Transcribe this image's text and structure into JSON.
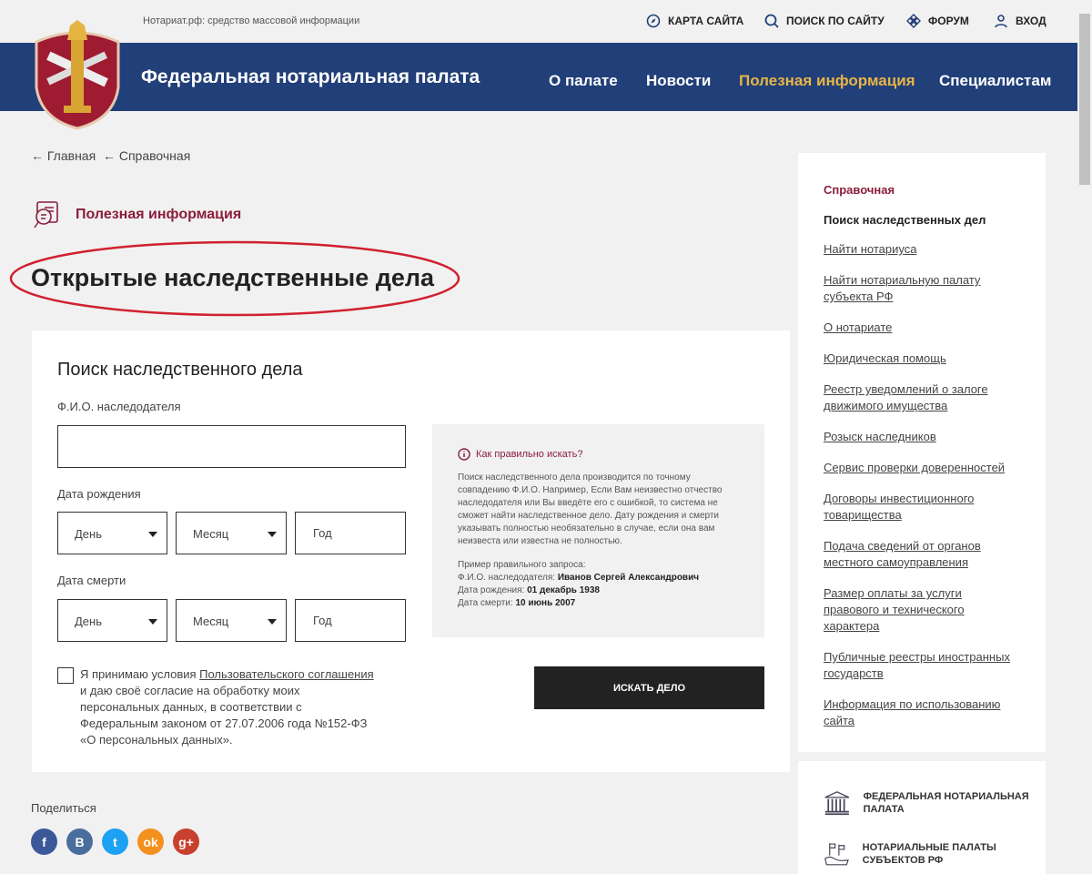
{
  "header": {
    "tagline": "Нотариат.рф: средство массовой информации",
    "site_title": "Федеральная нотариальная палата",
    "top_links": [
      {
        "label": "КАРТА САЙТА",
        "icon": "compass-icon"
      },
      {
        "label": "ПОИСК ПО САЙТУ",
        "icon": "search-icon"
      },
      {
        "label": "ФОРУМ",
        "icon": "forum-icon"
      },
      {
        "label": "ВХОД",
        "icon": "user-icon"
      }
    ],
    "nav": [
      {
        "label": "О палате"
      },
      {
        "label": "Новости"
      },
      {
        "label": "Полезная информация",
        "active": true
      },
      {
        "label": "Специалистам"
      }
    ],
    "colors": {
      "brand": "#213f78",
      "accent": "#e8b547",
      "section": "#8a1e3c"
    }
  },
  "breadcrumb": {
    "items": [
      "Главная",
      "Справочная"
    ]
  },
  "section_label": "Полезная информация",
  "page_title": "Открытые наследственные дела",
  "form": {
    "title": "Поиск наследственного дела",
    "name_label": "Ф.И.О. наследодателя",
    "name_value": "",
    "birth_label": "Дата рождения",
    "death_label": "Дата смерти",
    "day": "День",
    "month": "Месяц",
    "year": "Год",
    "agree_pre": "Я принимаю условия ",
    "agree_link": "Пользовательского соглашения",
    "agree_post": " и даю своё согласие на обработку моих персональных данных, в соответствии с Федеральным законом от 27.07.2006 года №152-ФЗ «О персональных данных».",
    "submit": "ИСКАТЬ ДЕЛО"
  },
  "hint": {
    "title": "Как правильно искать?",
    "text": "Поиск наследственного дела производится по точному совпадению Ф.И.О. Например, Если Вам неизвестно отчество наследодателя или Вы введёте его с ошибкой, то система не сможет найти наследственное дело. Дату рождения и смерти указывать полностью необязательно в случае, если она вам неизвеста или известна не полностью.",
    "example_title": "Пример правильного запроса:",
    "ex_name_label": "Ф.И.О. наследодателя: ",
    "ex_name": "Иванов Сергей Александрович",
    "ex_birth_label": "Дата рождения: ",
    "ex_birth": "01 декабрь 1938",
    "ex_death_label": "Дата смерти: ",
    "ex_death": "10 июнь 2007"
  },
  "sidebar": {
    "heading": "Справочная",
    "current": "Поиск наследственных дел",
    "links": [
      "Найти нотариуса",
      "Найти нотариальную палату субъекта РФ",
      "О нотариате",
      "Юридическая помощь",
      "Реестр уведомлений о залоге движимого имущества",
      "Розыск наследников",
      "Сервис проверки доверенностей",
      "Договоры инвестиционного товарищества",
      "Подача сведений от органов местного самоуправления",
      "Размер оплаты за услуги правового и технического характера",
      "Публичные реестры иностранных государств",
      "Информация по использованию сайта"
    ]
  },
  "sidebar2": {
    "items": [
      "ФЕДЕРАЛЬНАЯ НОТАРИАЛЬНАЯ ПАЛАТА",
      "НОТАРИАЛЬНЫЕ ПАЛАТЫ СУБЪЕКТОВ РФ"
    ]
  },
  "share": {
    "label": "Поделиться",
    "networks": [
      {
        "name": "facebook",
        "glyph": "f",
        "color": "#3b5998"
      },
      {
        "name": "vkontakte",
        "glyph": "В",
        "color": "#4a6e9c"
      },
      {
        "name": "twitter",
        "glyph": "t",
        "color": "#1da1f2"
      },
      {
        "name": "odnoklassniki",
        "glyph": "ok",
        "color": "#f4901e"
      },
      {
        "name": "google-plus",
        "glyph": "g+",
        "color": "#c8412f"
      }
    ]
  }
}
